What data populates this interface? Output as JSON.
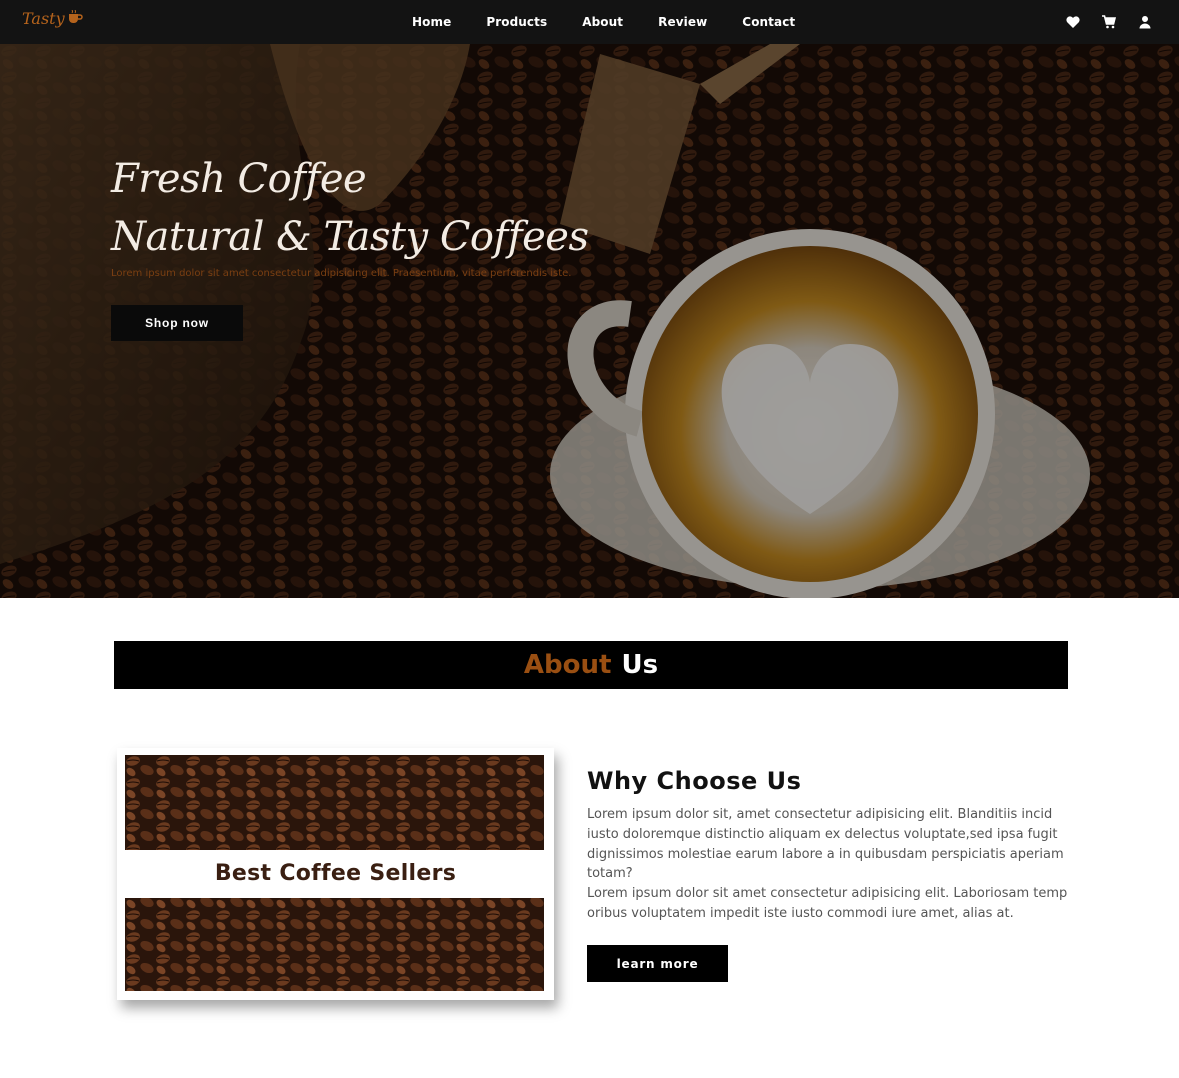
{
  "brand": {
    "logo_text": "Tasty",
    "accent": "#b5631c"
  },
  "nav": {
    "links": [
      "Home",
      "Products",
      "About",
      "Review",
      "Contact"
    ],
    "icons": [
      "heart-icon",
      "cart-icon",
      "user-icon"
    ]
  },
  "hero": {
    "title_line1": "Fresh Coffee",
    "title_line2": "Natural & Tasty Coffees",
    "subtitle": "Lorem ipsum dolor sit amet consectetur adipisicing elit. Praesentium, vitae perferendis iste.",
    "cta": "Shop now"
  },
  "about": {
    "heading_part1": "About",
    "heading_part2": "Us",
    "card_title": "Best Coffee Sellers",
    "why_title": "Why Choose Us",
    "paragraph1": "Lorem ipsum dolor sit, amet consectetur adipisicing elit. Blanditiis incid iusto doloremque distinctio aliquam ex delectus voluptate,sed ipsa fugit dignissimos molestiae earum labore a in quibusdam perspiciatis aperiam totam?",
    "paragraph2": "Lorem ipsum dolor sit amet consectetur adipisicing elit. Laboriosam temp oribus voluptatem impedit iste iusto commodi iure amet, alias at.",
    "cta": "learn more"
  }
}
